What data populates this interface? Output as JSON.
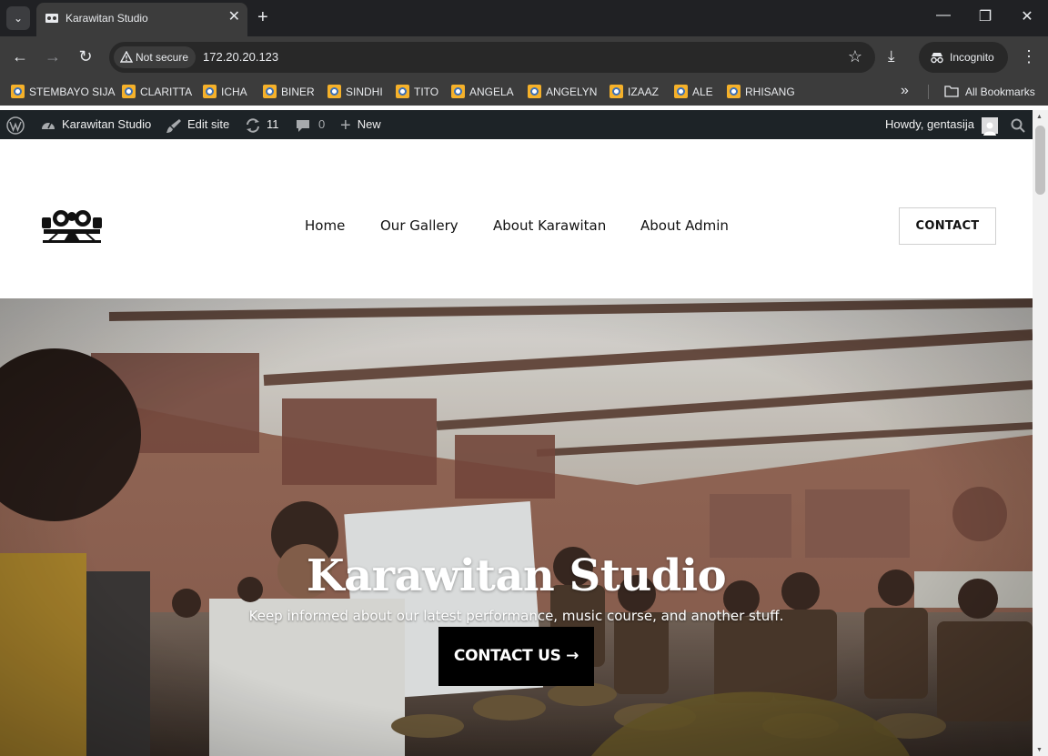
{
  "browser": {
    "tab_title": "Karawitan Studio",
    "new_tab_glyph": "+",
    "security_label": "Not secure",
    "url": "172.20.20.123",
    "incognito_label": "Incognito",
    "all_bookmarks_label": "All Bookmarks",
    "bookmarks": [
      {
        "label": "STEMBAYO SIJA"
      },
      {
        "label": "CLARITTA"
      },
      {
        "label": "ICHA"
      },
      {
        "label": "BINER"
      },
      {
        "label": "SINDHI"
      },
      {
        "label": "TITO"
      },
      {
        "label": "ANGELA"
      },
      {
        "label": "ANGELYN"
      },
      {
        "label": "IZAAZ"
      },
      {
        "label": "ALE"
      },
      {
        "label": "RHISANG"
      }
    ]
  },
  "adminbar": {
    "site_name": "Karawitan Studio",
    "edit_site": "Edit site",
    "updates_count": "11",
    "comments_count": "0",
    "new_label": "New",
    "howdy": "Howdy, gentasija"
  },
  "site": {
    "nav": [
      "Home",
      "Our Gallery",
      "About Karawitan",
      "About Admin"
    ],
    "contact_button": "CONTACT",
    "hero": {
      "title": "Karawitan Studio",
      "subtitle": "Keep informed about our latest performance, music course, and another stuff.",
      "cta": "CONTACT US →"
    }
  },
  "colors": {
    "chrome_dark": "#202124",
    "chrome_toolbar": "#3c3c3c",
    "wp_adminbar": "#1d2327",
    "cta_bg": "#000000"
  }
}
